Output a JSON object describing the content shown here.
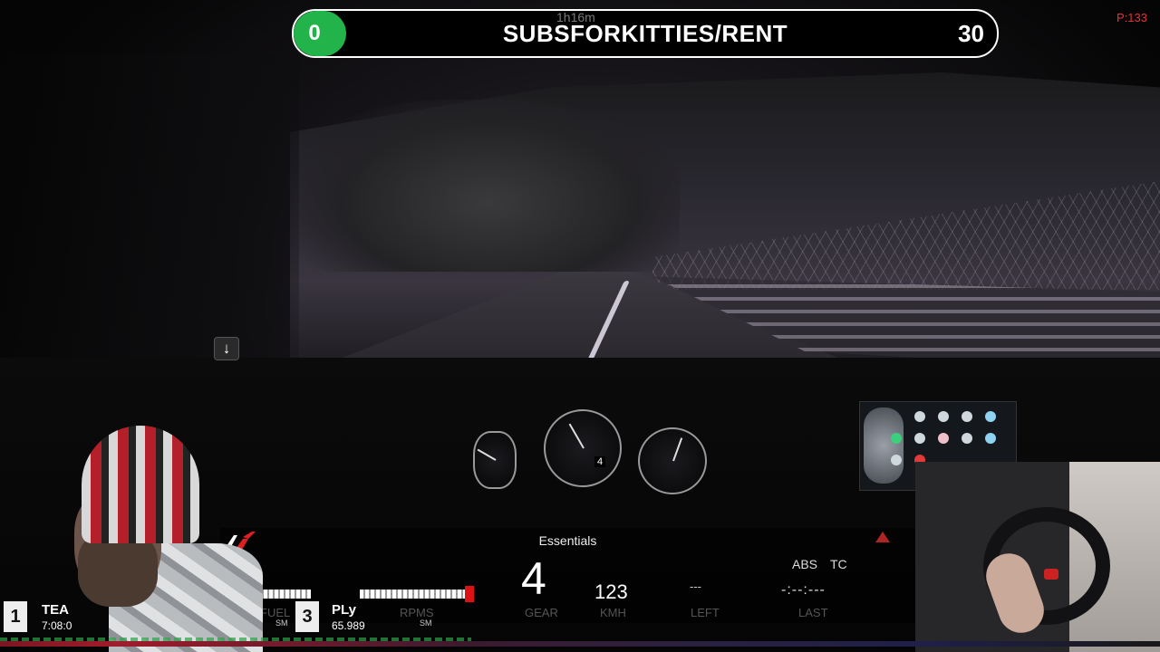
{
  "stream_banner": {
    "count": "0",
    "title": "SUBSFORKITTIES/RENT",
    "target": "30",
    "timer": "1h16m"
  },
  "corner_counter": "P:133",
  "dash_gauges": {
    "gear_display": "4"
  },
  "essentials": {
    "title": "Essentials",
    "gear": "4",
    "speed": "123",
    "abs_label": "ABS",
    "tc_label": "TC",
    "last_lap": "-:--:---",
    "labels": {
      "fuel": "FUEL",
      "rpms": "RPMS",
      "gear": "GEAR",
      "kmh": "KMH",
      "left": "LEFT",
      "last": "LAST"
    },
    "left_value": "---",
    "rpm_unit": "SM"
  },
  "standings": [
    {
      "position": "1",
      "name": "TEA",
      "time": "7:08:0"
    },
    {
      "position": "3",
      "name": "PLy",
      "time": "65.989"
    }
  ],
  "icons": {
    "scroll_down": "down-arrow-icon",
    "logo": "assetto-corsa-logo-icon",
    "warning": "warning-triangle-icon"
  },
  "colors": {
    "counter_green": "#22b34a",
    "alert_red": "#e3323a",
    "panel_bg": "#000000"
  }
}
